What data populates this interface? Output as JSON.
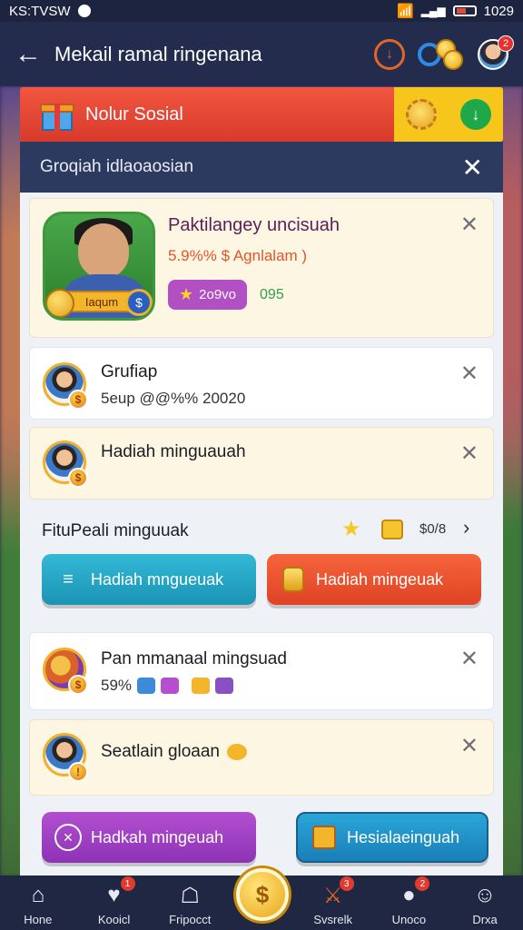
{
  "status_bar": {
    "left_text": "KS:TVSW",
    "time": "1029"
  },
  "app_bar": {
    "title": "Mekail ramal ringenana",
    "notification_count": "2"
  },
  "social_banner": {
    "label": "Nolur Sosial"
  },
  "panel": {
    "title": "Groqiah idlaoaosian",
    "cards": [
      {
        "name": "Paktilangey uncisuah",
        "detail": "5.9%% $ Agnlalam )",
        "pill_value": "2o9vo",
        "extra": "095",
        "plate": "Iaqum"
      },
      {
        "name": "Grufiap",
        "detail": "5eup @@%% 20020"
      },
      {
        "name": "Hadiah minguauah"
      }
    ],
    "section": {
      "title": "FituPeali minguuak",
      "counter": "$0/8",
      "buttons": [
        {
          "label": "Hadiah mngueuak"
        },
        {
          "label": "Hadiah mingeuak"
        }
      ]
    },
    "cards2": [
      {
        "name": "Pan mmanaal mingsuad",
        "detail": "59%"
      },
      {
        "name": "Seatlain gloaan"
      }
    ],
    "bottom_buttons": [
      {
        "label": "Hadkah mingeuah"
      },
      {
        "label": "Hesialaeinguah"
      }
    ]
  },
  "bottom_nav": [
    {
      "label": "Hone",
      "icon": "home-icon",
      "badge": ""
    },
    {
      "label": "Kooicl",
      "icon": "social-icon",
      "badge": "1"
    },
    {
      "label": "Fripocct",
      "icon": "house-icon",
      "badge": ""
    },
    {
      "label": "Svsrelk",
      "icon": "swords-icon",
      "badge": "3"
    },
    {
      "label": "Unoco",
      "icon": "chat-icon",
      "badge": "2"
    },
    {
      "label": "Drxa",
      "icon": "profile-icon",
      "badge": ""
    }
  ],
  "colors": {
    "banner_red": "#f25540",
    "banner_yellow": "#f6c61c",
    "panel_header": "#2c3a5f",
    "teal": "#33b9d6",
    "orange": "#f6643c",
    "purple": "#b24fd0"
  }
}
